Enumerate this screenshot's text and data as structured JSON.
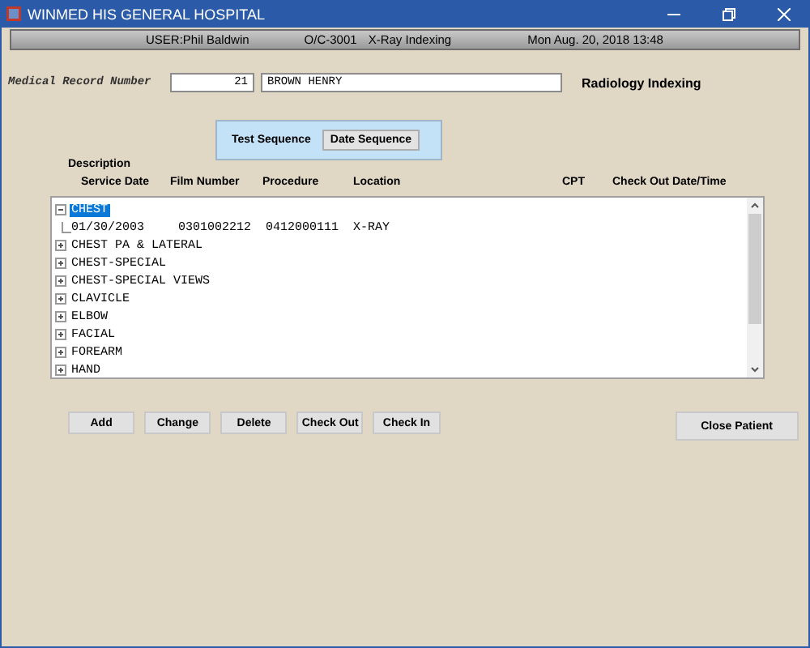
{
  "window": {
    "title": "WINMED HIS GENERAL HOSPITAL"
  },
  "status_bar": {
    "user": "USER:Phil Baldwin",
    "code": "O/C-3001",
    "module": "X-Ray Indexing",
    "datetime": "Mon Aug. 20, 2018 13:48"
  },
  "patient": {
    "label": "Medical Record Number",
    "record_number": "21",
    "name": "BROWN HENRY",
    "section_title": "Radiology Indexing"
  },
  "sequence_tabs": [
    {
      "label": "Test Sequence",
      "selected": true
    },
    {
      "label": "Date Sequence",
      "selected": false
    }
  ],
  "description_label": "Description",
  "columns": [
    "Service Date",
    "Film Number",
    "Procedure",
    "Location",
    "CPT",
    "Check Out Date/Time"
  ],
  "tree": [
    {
      "label": "CHEST",
      "selected": true,
      "expanded": true,
      "children": [
        {
          "service_date": "01/30/2003",
          "film_number": "0301002212",
          "procedure": "0412000111",
          "location": "X-RAY"
        }
      ]
    },
    {
      "label": "CHEST PA & LATERAL",
      "selected": false,
      "expanded": false
    },
    {
      "label": "CHEST-SPECIAL",
      "selected": false,
      "expanded": false
    },
    {
      "label": "CHEST-SPECIAL VIEWS",
      "selected": false,
      "expanded": false
    },
    {
      "label": "CLAVICLE",
      "selected": false,
      "expanded": false
    },
    {
      "label": "ELBOW",
      "selected": false,
      "expanded": false
    },
    {
      "label": "FACIAL",
      "selected": false,
      "expanded": false
    },
    {
      "label": "FOREARM",
      "selected": false,
      "expanded": false
    },
    {
      "label": "HAND",
      "selected": false,
      "expanded": false
    }
  ],
  "buttons": [
    "Add",
    "Change",
    "Delete",
    "Check Out",
    "Check In"
  ],
  "close_button": "Close Patient"
}
